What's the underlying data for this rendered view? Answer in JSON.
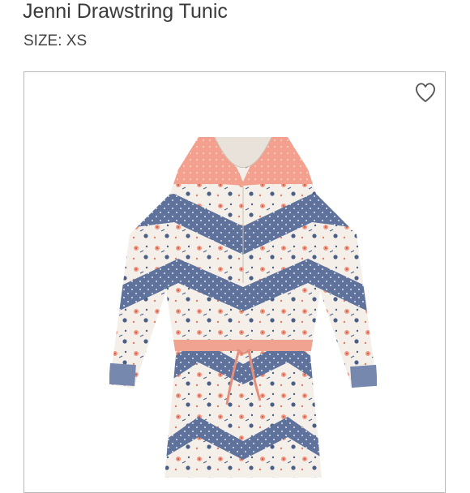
{
  "product": {
    "title": "Jenni Drawstring Tunic",
    "size_label": "SIZE: XS"
  },
  "icons": {
    "favorite": "heart-outline-icon"
  },
  "image": {
    "subject": "tunic-product-photo"
  },
  "colors": {
    "print_navy": "#4b5f86",
    "print_coral": "#f29a86",
    "print_cream": "#f3efe8",
    "border": "#b9b9b9"
  }
}
